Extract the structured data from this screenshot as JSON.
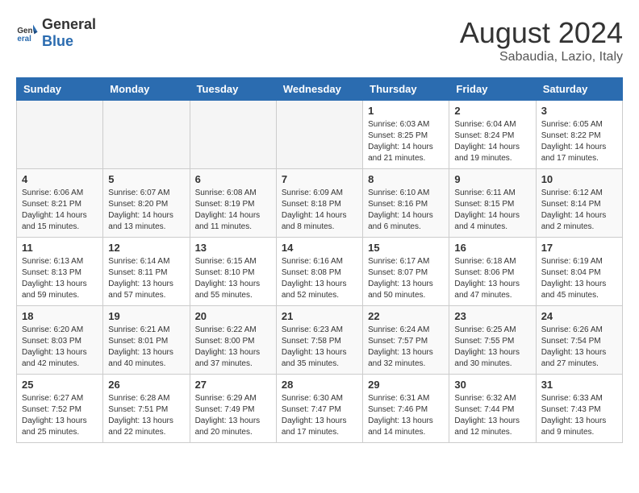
{
  "header": {
    "logo_general": "General",
    "logo_blue": "Blue",
    "month_year": "August 2024",
    "location": "Sabaudia, Lazio, Italy"
  },
  "weekdays": [
    "Sunday",
    "Monday",
    "Tuesday",
    "Wednesday",
    "Thursday",
    "Friday",
    "Saturday"
  ],
  "weeks": [
    [
      {
        "day": "",
        "info": ""
      },
      {
        "day": "",
        "info": ""
      },
      {
        "day": "",
        "info": ""
      },
      {
        "day": "",
        "info": ""
      },
      {
        "day": "1",
        "info": "Sunrise: 6:03 AM\nSunset: 8:25 PM\nDaylight: 14 hours\nand 21 minutes."
      },
      {
        "day": "2",
        "info": "Sunrise: 6:04 AM\nSunset: 8:24 PM\nDaylight: 14 hours\nand 19 minutes."
      },
      {
        "day": "3",
        "info": "Sunrise: 6:05 AM\nSunset: 8:22 PM\nDaylight: 14 hours\nand 17 minutes."
      }
    ],
    [
      {
        "day": "4",
        "info": "Sunrise: 6:06 AM\nSunset: 8:21 PM\nDaylight: 14 hours\nand 15 minutes."
      },
      {
        "day": "5",
        "info": "Sunrise: 6:07 AM\nSunset: 8:20 PM\nDaylight: 14 hours\nand 13 minutes."
      },
      {
        "day": "6",
        "info": "Sunrise: 6:08 AM\nSunset: 8:19 PM\nDaylight: 14 hours\nand 11 minutes."
      },
      {
        "day": "7",
        "info": "Sunrise: 6:09 AM\nSunset: 8:18 PM\nDaylight: 14 hours\nand 8 minutes."
      },
      {
        "day": "8",
        "info": "Sunrise: 6:10 AM\nSunset: 8:16 PM\nDaylight: 14 hours\nand 6 minutes."
      },
      {
        "day": "9",
        "info": "Sunrise: 6:11 AM\nSunset: 8:15 PM\nDaylight: 14 hours\nand 4 minutes."
      },
      {
        "day": "10",
        "info": "Sunrise: 6:12 AM\nSunset: 8:14 PM\nDaylight: 14 hours\nand 2 minutes."
      }
    ],
    [
      {
        "day": "11",
        "info": "Sunrise: 6:13 AM\nSunset: 8:13 PM\nDaylight: 13 hours\nand 59 minutes."
      },
      {
        "day": "12",
        "info": "Sunrise: 6:14 AM\nSunset: 8:11 PM\nDaylight: 13 hours\nand 57 minutes."
      },
      {
        "day": "13",
        "info": "Sunrise: 6:15 AM\nSunset: 8:10 PM\nDaylight: 13 hours\nand 55 minutes."
      },
      {
        "day": "14",
        "info": "Sunrise: 6:16 AM\nSunset: 8:08 PM\nDaylight: 13 hours\nand 52 minutes."
      },
      {
        "day": "15",
        "info": "Sunrise: 6:17 AM\nSunset: 8:07 PM\nDaylight: 13 hours\nand 50 minutes."
      },
      {
        "day": "16",
        "info": "Sunrise: 6:18 AM\nSunset: 8:06 PM\nDaylight: 13 hours\nand 47 minutes."
      },
      {
        "day": "17",
        "info": "Sunrise: 6:19 AM\nSunset: 8:04 PM\nDaylight: 13 hours\nand 45 minutes."
      }
    ],
    [
      {
        "day": "18",
        "info": "Sunrise: 6:20 AM\nSunset: 8:03 PM\nDaylight: 13 hours\nand 42 minutes."
      },
      {
        "day": "19",
        "info": "Sunrise: 6:21 AM\nSunset: 8:01 PM\nDaylight: 13 hours\nand 40 minutes."
      },
      {
        "day": "20",
        "info": "Sunrise: 6:22 AM\nSunset: 8:00 PM\nDaylight: 13 hours\nand 37 minutes."
      },
      {
        "day": "21",
        "info": "Sunrise: 6:23 AM\nSunset: 7:58 PM\nDaylight: 13 hours\nand 35 minutes."
      },
      {
        "day": "22",
        "info": "Sunrise: 6:24 AM\nSunset: 7:57 PM\nDaylight: 13 hours\nand 32 minutes."
      },
      {
        "day": "23",
        "info": "Sunrise: 6:25 AM\nSunset: 7:55 PM\nDaylight: 13 hours\nand 30 minutes."
      },
      {
        "day": "24",
        "info": "Sunrise: 6:26 AM\nSunset: 7:54 PM\nDaylight: 13 hours\nand 27 minutes."
      }
    ],
    [
      {
        "day": "25",
        "info": "Sunrise: 6:27 AM\nSunset: 7:52 PM\nDaylight: 13 hours\nand 25 minutes."
      },
      {
        "day": "26",
        "info": "Sunrise: 6:28 AM\nSunset: 7:51 PM\nDaylight: 13 hours\nand 22 minutes."
      },
      {
        "day": "27",
        "info": "Sunrise: 6:29 AM\nSunset: 7:49 PM\nDaylight: 13 hours\nand 20 minutes."
      },
      {
        "day": "28",
        "info": "Sunrise: 6:30 AM\nSunset: 7:47 PM\nDaylight: 13 hours\nand 17 minutes."
      },
      {
        "day": "29",
        "info": "Sunrise: 6:31 AM\nSunset: 7:46 PM\nDaylight: 13 hours\nand 14 minutes."
      },
      {
        "day": "30",
        "info": "Sunrise: 6:32 AM\nSunset: 7:44 PM\nDaylight: 13 hours\nand 12 minutes."
      },
      {
        "day": "31",
        "info": "Sunrise: 6:33 AM\nSunset: 7:43 PM\nDaylight: 13 hours\nand 9 minutes."
      }
    ]
  ]
}
